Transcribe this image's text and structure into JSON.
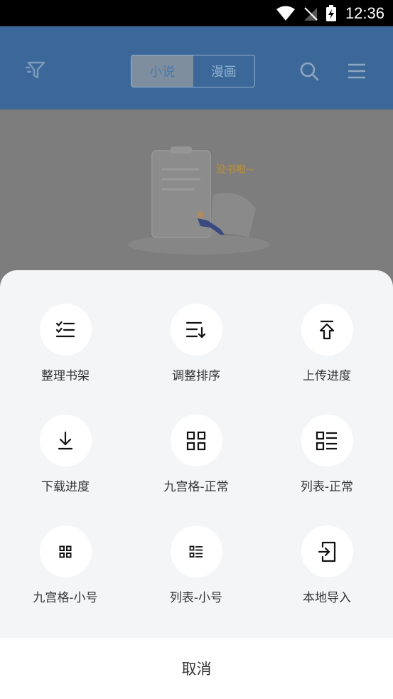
{
  "status_bar": {
    "time": "12:36"
  },
  "header": {
    "tabs": [
      {
        "label": "小说",
        "active": true
      },
      {
        "label": "漫画",
        "active": false
      }
    ]
  },
  "empty_state": {
    "text": "没书啦~"
  },
  "sheet": {
    "items": [
      {
        "label": "整理书架",
        "icon": "checklist-icon"
      },
      {
        "label": "调整排序",
        "icon": "sort-icon"
      },
      {
        "label": "上传进度",
        "icon": "upload-icon"
      },
      {
        "label": "下载进度",
        "icon": "download-icon"
      },
      {
        "label": "九宫格-正常",
        "icon": "grid-icon"
      },
      {
        "label": "列表-正常",
        "icon": "list-icon"
      },
      {
        "label": "九宫格-小号",
        "icon": "grid-small-icon"
      },
      {
        "label": "列表-小号",
        "icon": "list-small-icon"
      },
      {
        "label": "本地导入",
        "icon": "import-icon"
      }
    ],
    "cancel_label": "取消"
  },
  "colors": {
    "header_bg": "#3b6899",
    "sheet_bg": "#f4f5f7",
    "overlay": "#7a7a7a"
  }
}
